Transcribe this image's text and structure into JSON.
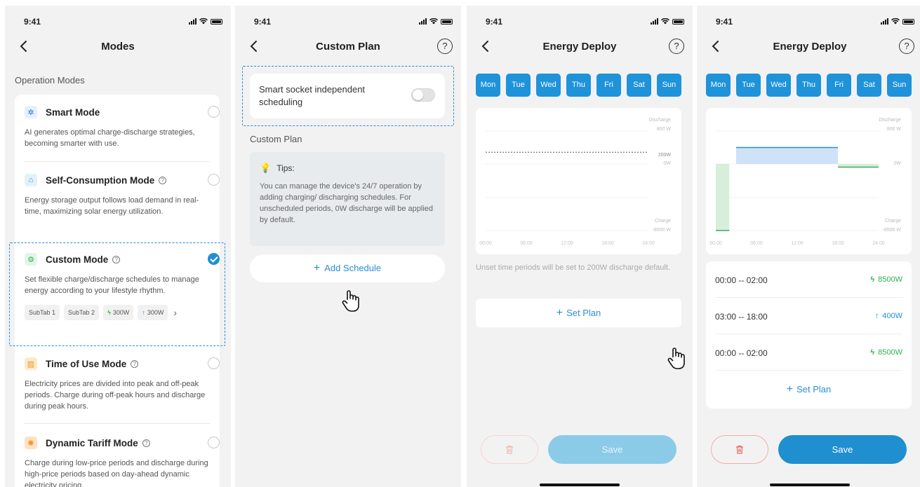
{
  "status": {
    "time": "9:41"
  },
  "screen1": {
    "title": "Modes",
    "section": "Operation Modes",
    "modes": [
      {
        "name": "Smart Mode",
        "desc": "AI generates optimal charge-discharge strategies, becoming smarter with use.",
        "icon": "smart-mode-icon",
        "selected": false
      },
      {
        "name": "Self-Consumption Mode",
        "desc": "Energy storage output follows load demand in real-time, maximizing solar energy utilization.",
        "icon": "house-icon",
        "selected": false
      },
      {
        "name": "Custom Mode",
        "desc": "Set flexible charge/discharge schedules to manage energy according to your lifestyle rhythm.",
        "icon": "gear-icon",
        "selected": true
      },
      {
        "name": "Time of Use Mode",
        "desc": "Electricity prices are divided into peak and off-peak periods. Charge during off-peak hours and discharge during peak hours.",
        "icon": "building-icon",
        "selected": false
      },
      {
        "name": "Dynamic Tariff Mode",
        "desc": "Charge during low-price periods and discharge during high-price periods based on day-ahead dynamic electricity pricing.",
        "icon": "tariff-icon",
        "selected": false
      }
    ],
    "chips": [
      "SubTab 1",
      "SubTab 2",
      "300W",
      "300W"
    ]
  },
  "screen2": {
    "title": "Custom Plan",
    "toggle_label": "Smart socket independent scheduling",
    "toggle_on": false,
    "section": "Custom Plan",
    "tips_title": "Tips:",
    "tips_body": "You can manage the device's 24/7 operation by adding charging/ discharging schedules. For unscheduled periods, 0W discharge will be applied by default.",
    "add_label": "Add Schedule"
  },
  "screen3": {
    "title": "Energy Deploy",
    "days": [
      "Mon",
      "Tue",
      "Wed",
      "Thu",
      "Fri",
      "Sat",
      "Sun"
    ],
    "note": "Unset time periods will be set to 200W discharge default.",
    "setplan_label": "Set Plan",
    "save_label": "Save"
  },
  "screen4": {
    "title": "Energy Deploy",
    "days": [
      "Mon",
      "Tue",
      "Wed",
      "Thu",
      "Fri",
      "Sat",
      "Sun"
    ],
    "schedules": [
      {
        "time": "00:00 -- 02:00",
        "power": "8500W",
        "type": "charge"
      },
      {
        "time": "03:00 -- 18:00",
        "power": "400W",
        "type": "discharge"
      },
      {
        "time": "00:00 -- 02:00",
        "power": "8500W",
        "type": "charge"
      }
    ],
    "setplan_label": "Set Plan",
    "save_label": "Save"
  },
  "chart_data": [
    {
      "type": "area",
      "x_ticks": [
        "00:00",
        "06:00",
        "12:00",
        "18:00",
        "24:00"
      ],
      "y_labels_right": [
        "Discharge",
        "800 W",
        "200W",
        "0W",
        "Charge",
        "-8500 W"
      ],
      "baseline_dashed_W": 200,
      "series": []
    },
    {
      "type": "area",
      "x_ticks": [
        "00:00",
        "06:00",
        "12:00",
        "18:00",
        "24:00"
      ],
      "y_labels_right": [
        "Discharge",
        "800 W",
        "0W",
        "Charge",
        "-8500 W"
      ],
      "series": [
        {
          "segments": [
            {
              "start_h": 0,
              "end_h": 2,
              "watts": -8500
            },
            {
              "start_h": 3,
              "end_h": 18,
              "watts": 400
            },
            {
              "start_h": 18,
              "end_h": 24,
              "watts": -400
            }
          ]
        }
      ]
    }
  ],
  "colors": {
    "accent": "#1f8fd8",
    "charge": "#2bb24c",
    "delete": "#e86a5a"
  }
}
